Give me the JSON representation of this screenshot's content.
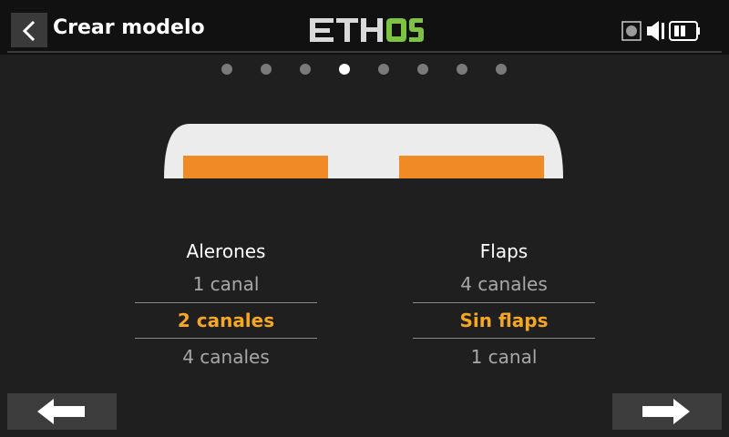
{
  "header": {
    "title": "Crear modelo",
    "logo_text": "ETHOS",
    "logo_colors": {
      "primary": "#d9d9d9",
      "accent": "#7dc242"
    }
  },
  "pager": {
    "count": 8,
    "active_index": 3
  },
  "colors": {
    "accent": "#f5a623",
    "surface": "#ececec",
    "servo": "#f08a24"
  },
  "columns": {
    "ailerons": {
      "title": "Alerones",
      "options": [
        "1 canal",
        "2 canales",
        "4 canales"
      ],
      "selected_index": 1
    },
    "flaps": {
      "title": "Flaps",
      "options": [
        "4 canales",
        "Sin flaps",
        "1 canal"
      ],
      "selected_index": 1
    }
  },
  "nav": {
    "prev_icon": "arrow-left-icon",
    "next_icon": "arrow-right-icon"
  }
}
